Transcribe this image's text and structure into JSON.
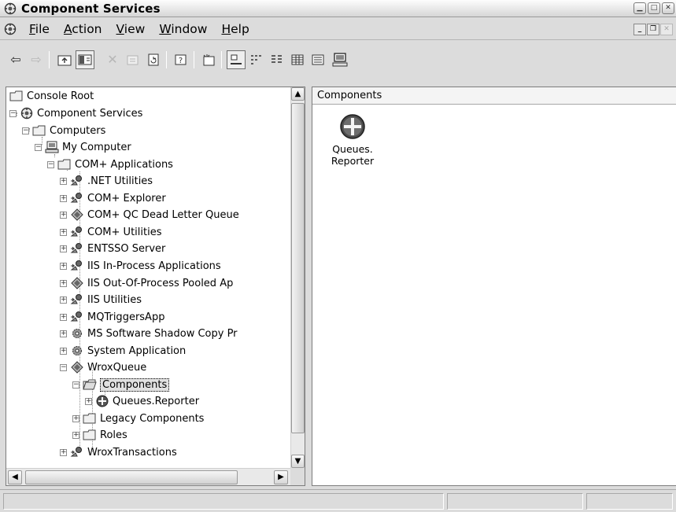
{
  "window": {
    "title": "Component Services"
  },
  "menu": [
    {
      "pre": "",
      "ul": "F",
      "post": "ile"
    },
    {
      "pre": "",
      "ul": "A",
      "post": "ction"
    },
    {
      "pre": "",
      "ul": "V",
      "post": "iew"
    },
    {
      "pre": "",
      "ul": "W",
      "post": "indow"
    },
    {
      "pre": "",
      "ul": "H",
      "post": "elp"
    }
  ],
  "tree": {
    "items": [
      {
        "label": "Console Root",
        "icon": "folder-icon"
      },
      {
        "label": "Component Services",
        "icon": "component-services-icon"
      },
      {
        "label": "Computers",
        "icon": "folder-icon"
      },
      {
        "label": "My Computer",
        "icon": "computer-icon"
      },
      {
        "label": "COM+ Applications",
        "icon": "folder-icon"
      },
      {
        "label": ".NET Utilities",
        "icon": "application-icon"
      },
      {
        "label": "COM+ Explorer",
        "icon": "application-icon"
      },
      {
        "label": "COM+ QC Dead Letter Queue",
        "icon": "queued-application-icon"
      },
      {
        "label": "COM+ Utilities",
        "icon": "application-icon"
      },
      {
        "label": "ENTSSO Server",
        "icon": "application-icon"
      },
      {
        "label": "IIS In-Process Applications",
        "icon": "application-icon"
      },
      {
        "label": "IIS Out-Of-Process Pooled Ap",
        "icon": "queued-application-icon"
      },
      {
        "label": "IIS Utilities",
        "icon": "application-icon"
      },
      {
        "label": "MQTriggersApp",
        "icon": "application-icon"
      },
      {
        "label": "MS Software Shadow Copy Pr",
        "icon": "system-application-icon"
      },
      {
        "label": "System Application",
        "icon": "system-application-icon"
      },
      {
        "label": "WroxQueue",
        "icon": "queued-application-icon"
      },
      {
        "label": "Components",
        "icon": "open-folder-icon"
      },
      {
        "label": "Queues.Reporter",
        "icon": "component-icon"
      },
      {
        "label": "Legacy Components",
        "icon": "folder-icon"
      },
      {
        "label": "Roles",
        "icon": "folder-icon"
      },
      {
        "label": "WroxTransactions",
        "icon": "application-icon"
      }
    ]
  },
  "right": {
    "header": "Components",
    "items": [
      {
        "line1": "Queues.",
        "line2": "Reporter",
        "icon": "component-icon"
      }
    ]
  },
  "colors": {
    "background": "#dcdcdc",
    "pane": "#ffffff",
    "border": "#7c7c7c"
  }
}
